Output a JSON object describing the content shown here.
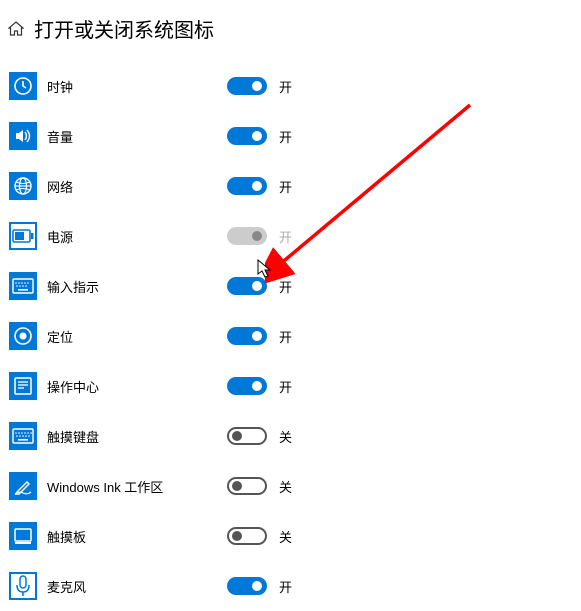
{
  "header": {
    "title": "打开或关闭系统图标"
  },
  "stateLabels": {
    "on": "开",
    "off": "关",
    "disabledOn": "开"
  },
  "items": [
    {
      "id": "clock",
      "label": "时钟",
      "state": "on"
    },
    {
      "id": "volume",
      "label": "音量",
      "state": "on"
    },
    {
      "id": "network",
      "label": "网络",
      "state": "on"
    },
    {
      "id": "power",
      "label": "电源",
      "state": "disabled"
    },
    {
      "id": "ime",
      "label": "输入指示",
      "state": "on"
    },
    {
      "id": "location",
      "label": "定位",
      "state": "on"
    },
    {
      "id": "action",
      "label": "操作中心",
      "state": "on"
    },
    {
      "id": "touchkey",
      "label": "触摸键盘",
      "state": "off"
    },
    {
      "id": "ink",
      "label": "Windows Ink 工作区",
      "state": "off"
    },
    {
      "id": "touchpad",
      "label": "触摸板",
      "state": "off"
    },
    {
      "id": "mic",
      "label": "麦克风",
      "state": "on"
    }
  ],
  "annotation": {
    "cursor": true,
    "arrowColor": "#ff0000",
    "arrowTargetItem": "ime"
  }
}
